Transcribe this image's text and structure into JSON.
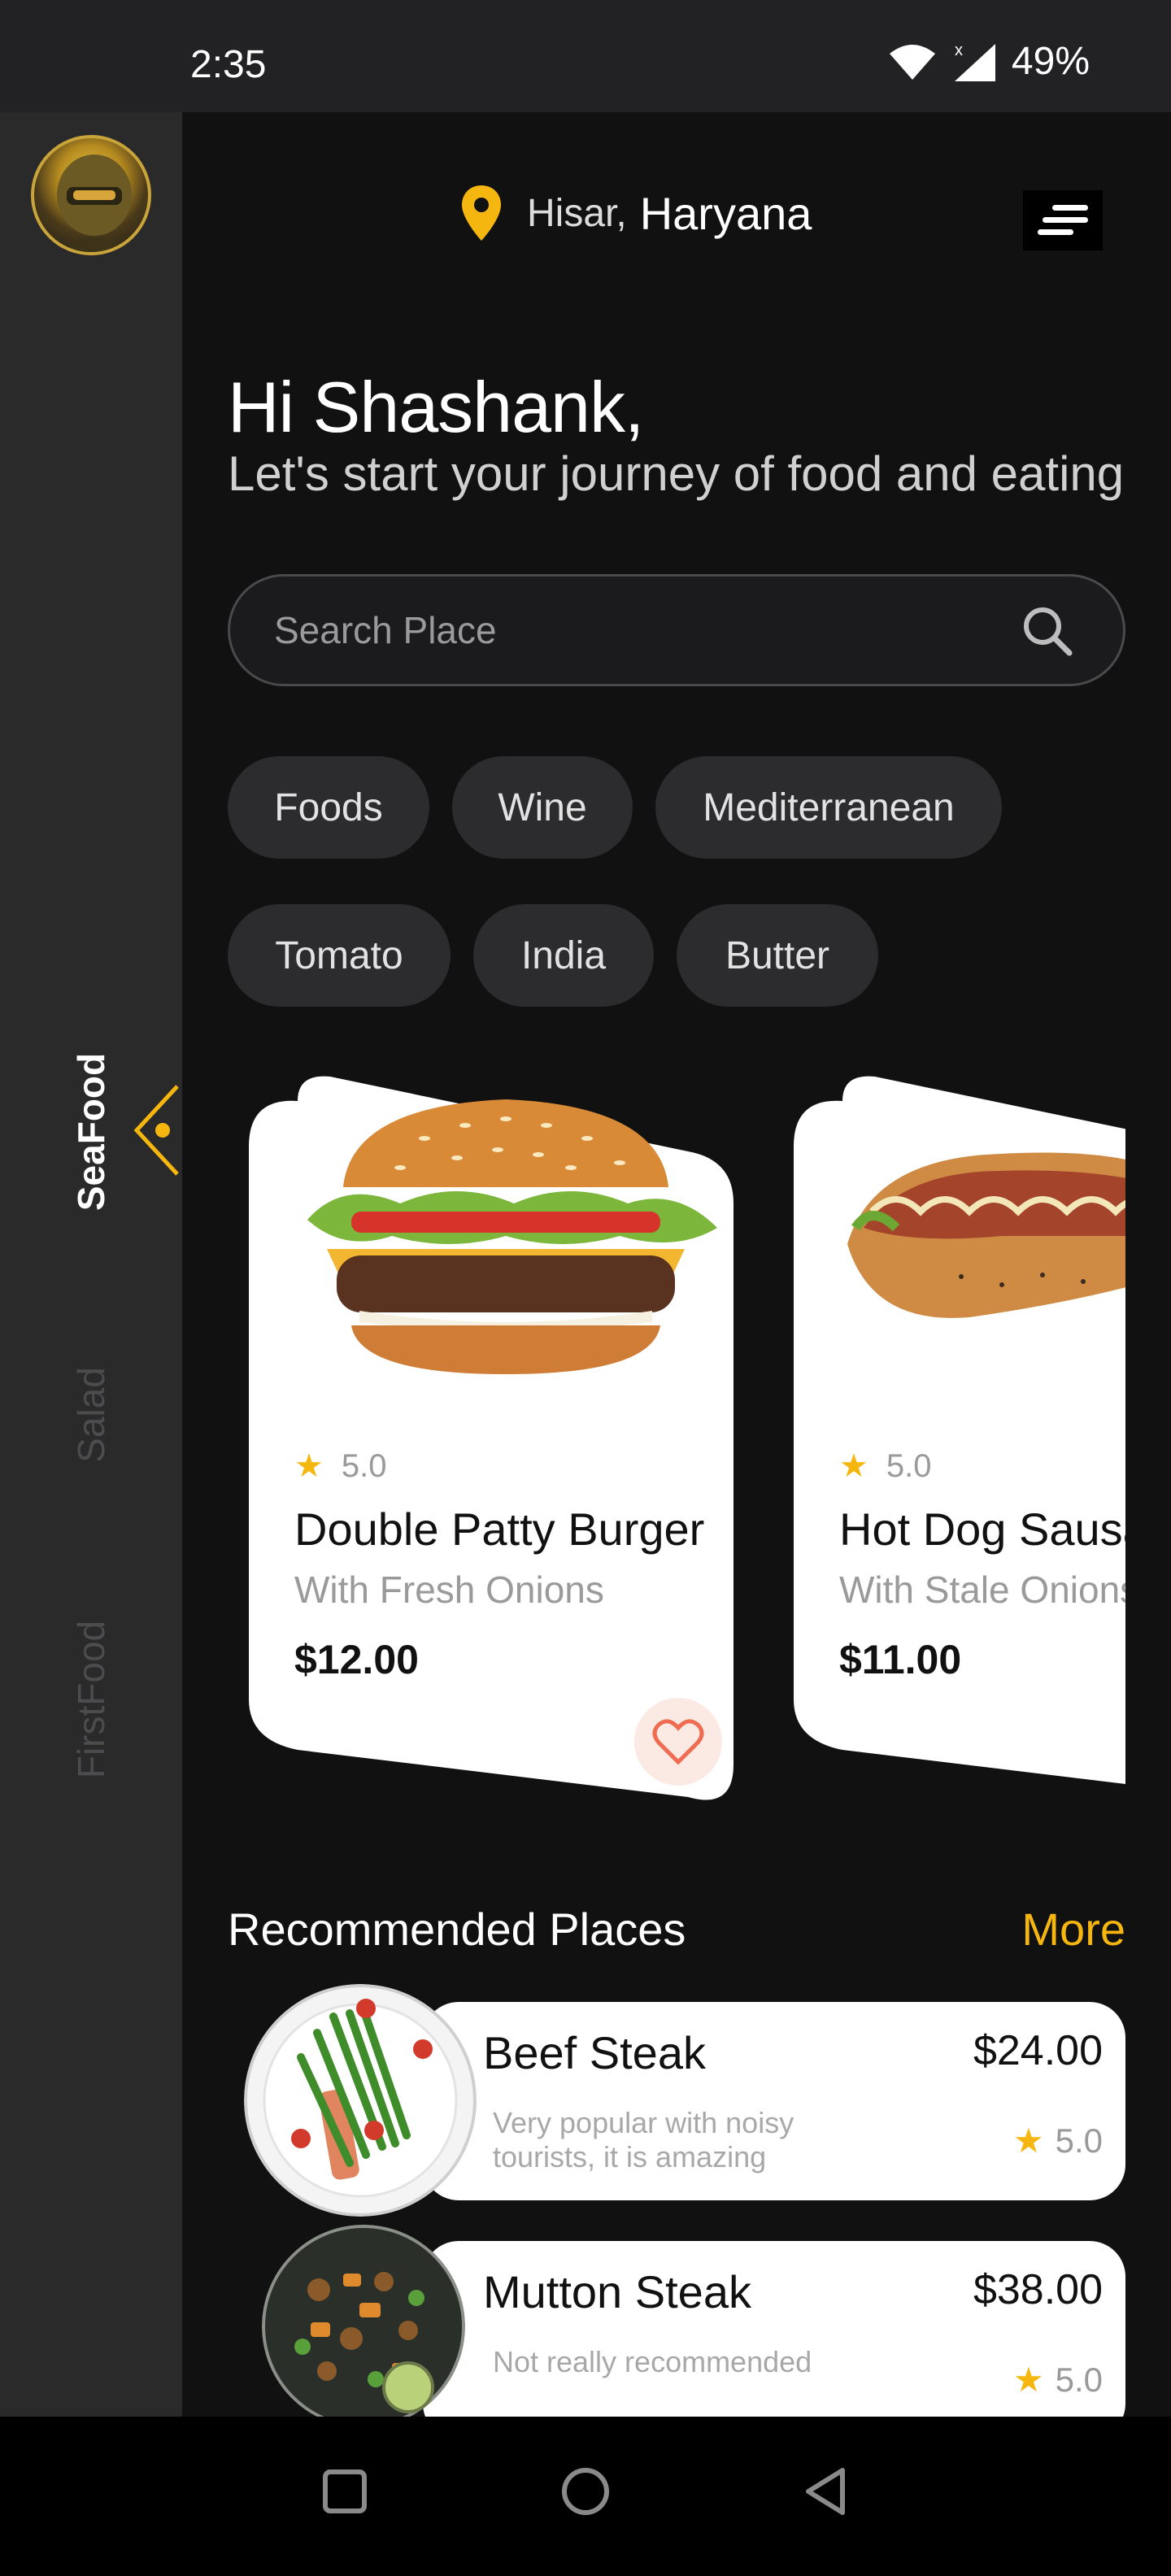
{
  "status_bar": {
    "time": "2:35",
    "battery": "49%"
  },
  "sidebar": {
    "tabs": [
      {
        "label": "SeaFood",
        "active": true
      },
      {
        "label": "Salad",
        "active": false
      },
      {
        "label": "FirstFood",
        "active": false
      }
    ]
  },
  "header": {
    "city": "Hisar,",
    "state": "Haryana"
  },
  "greeting": {
    "title": "Hi Shashank,",
    "subtitle": "Let's start your journey of food and eating"
  },
  "search": {
    "placeholder": "Search Place"
  },
  "chips": [
    "Foods",
    "Wine",
    "Mediterranean",
    "Tomato",
    "India",
    "Butter"
  ],
  "food_cards": [
    {
      "rating": "5.0",
      "title": "Double Patty Burger",
      "subtitle": "With Fresh Onions",
      "price": "$12.00"
    },
    {
      "rating": "5.0",
      "title": "Hot Dog Sausage",
      "subtitle": "With Stale Onions",
      "price": "$11.00"
    }
  ],
  "recommended": {
    "title": "Recommended Places",
    "more": "More",
    "items": [
      {
        "name": "Beef Steak",
        "description": "Very popular with noisy tourists, it is amazing",
        "price": "$24.00",
        "rating": "5.0"
      },
      {
        "name": "Mutton Steak",
        "description": "Not really recommended",
        "price": "$38.00",
        "rating": "5.0"
      }
    ]
  },
  "colors": {
    "accent": "#f5b70f",
    "background": "#111112",
    "sidebar": "#2a2a2b",
    "card": "#ffffff"
  },
  "icons": [
    "wifi-icon",
    "signal-icon",
    "location-pin-icon",
    "menu-icon",
    "search-icon",
    "star-icon",
    "heart-icon",
    "chevron-left-icon",
    "square-icon",
    "circle-icon",
    "back-triangle-icon"
  ]
}
